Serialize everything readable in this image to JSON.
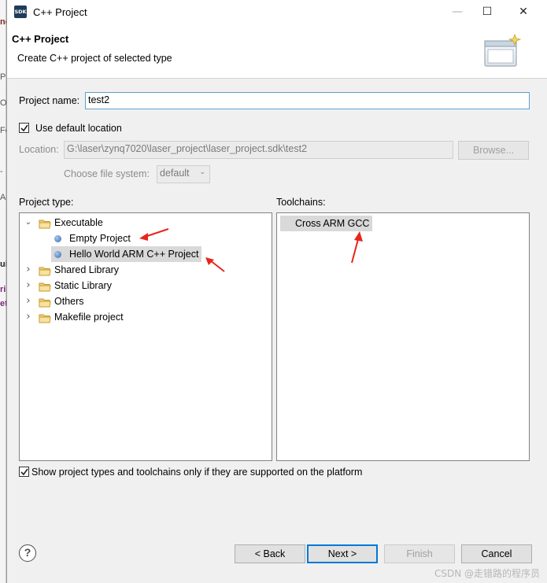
{
  "window": {
    "app_icon_text": "SDK",
    "title": "C++ Project",
    "minimize": "—",
    "maximize": "☐",
    "close": "✕"
  },
  "header": {
    "title": "C++ Project",
    "description": "Create C++ project of selected type"
  },
  "form": {
    "project_name_label": "Project name:",
    "project_name_value": "test2",
    "use_default_location_label": "Use default location",
    "use_default_location_checked": true,
    "location_label": "Location:",
    "location_value": "G:\\laser\\zynq7020\\laser_project\\laser_project.sdk\\test2",
    "browse_label": "Browse...",
    "file_system_label": "Choose file system:",
    "file_system_value": "default"
  },
  "project_type": {
    "label": "Project type:",
    "items": [
      {
        "label": "Executable",
        "kind": "folder",
        "expanded": true,
        "level": 0
      },
      {
        "label": "Empty Project",
        "kind": "leaf",
        "level": 1
      },
      {
        "label": "Hello World ARM C++ Project",
        "kind": "leaf",
        "level": 1,
        "selected": true
      },
      {
        "label": "Shared Library",
        "kind": "folder",
        "expanded": false,
        "level": 0
      },
      {
        "label": "Static Library",
        "kind": "folder",
        "expanded": false,
        "level": 0
      },
      {
        "label": "Others",
        "kind": "folder",
        "expanded": false,
        "level": 0
      },
      {
        "label": "Makefile project",
        "kind": "folder",
        "expanded": false,
        "level": 0
      }
    ]
  },
  "toolchains": {
    "label": "Toolchains:",
    "items": [
      "Cross ARM GCC"
    ]
  },
  "filter": {
    "label": "Show project types and toolchains only if they are supported on the platform",
    "checked": true
  },
  "buttons": {
    "back": "< Back",
    "next": "Next >",
    "finish": "Finish",
    "cancel": "Cancel",
    "help": "?"
  },
  "watermark": "CSDN @走错路的程序员",
  "background_fragments": [
    "nc",
    "Pr",
    "O",
    "Fc",
    "-",
    "Ac",
    "ui",
    "ri",
    "et"
  ],
  "colors": {
    "accent": "#0078d7",
    "arrow": "#e8251c",
    "selection": "#d9d9d9"
  }
}
